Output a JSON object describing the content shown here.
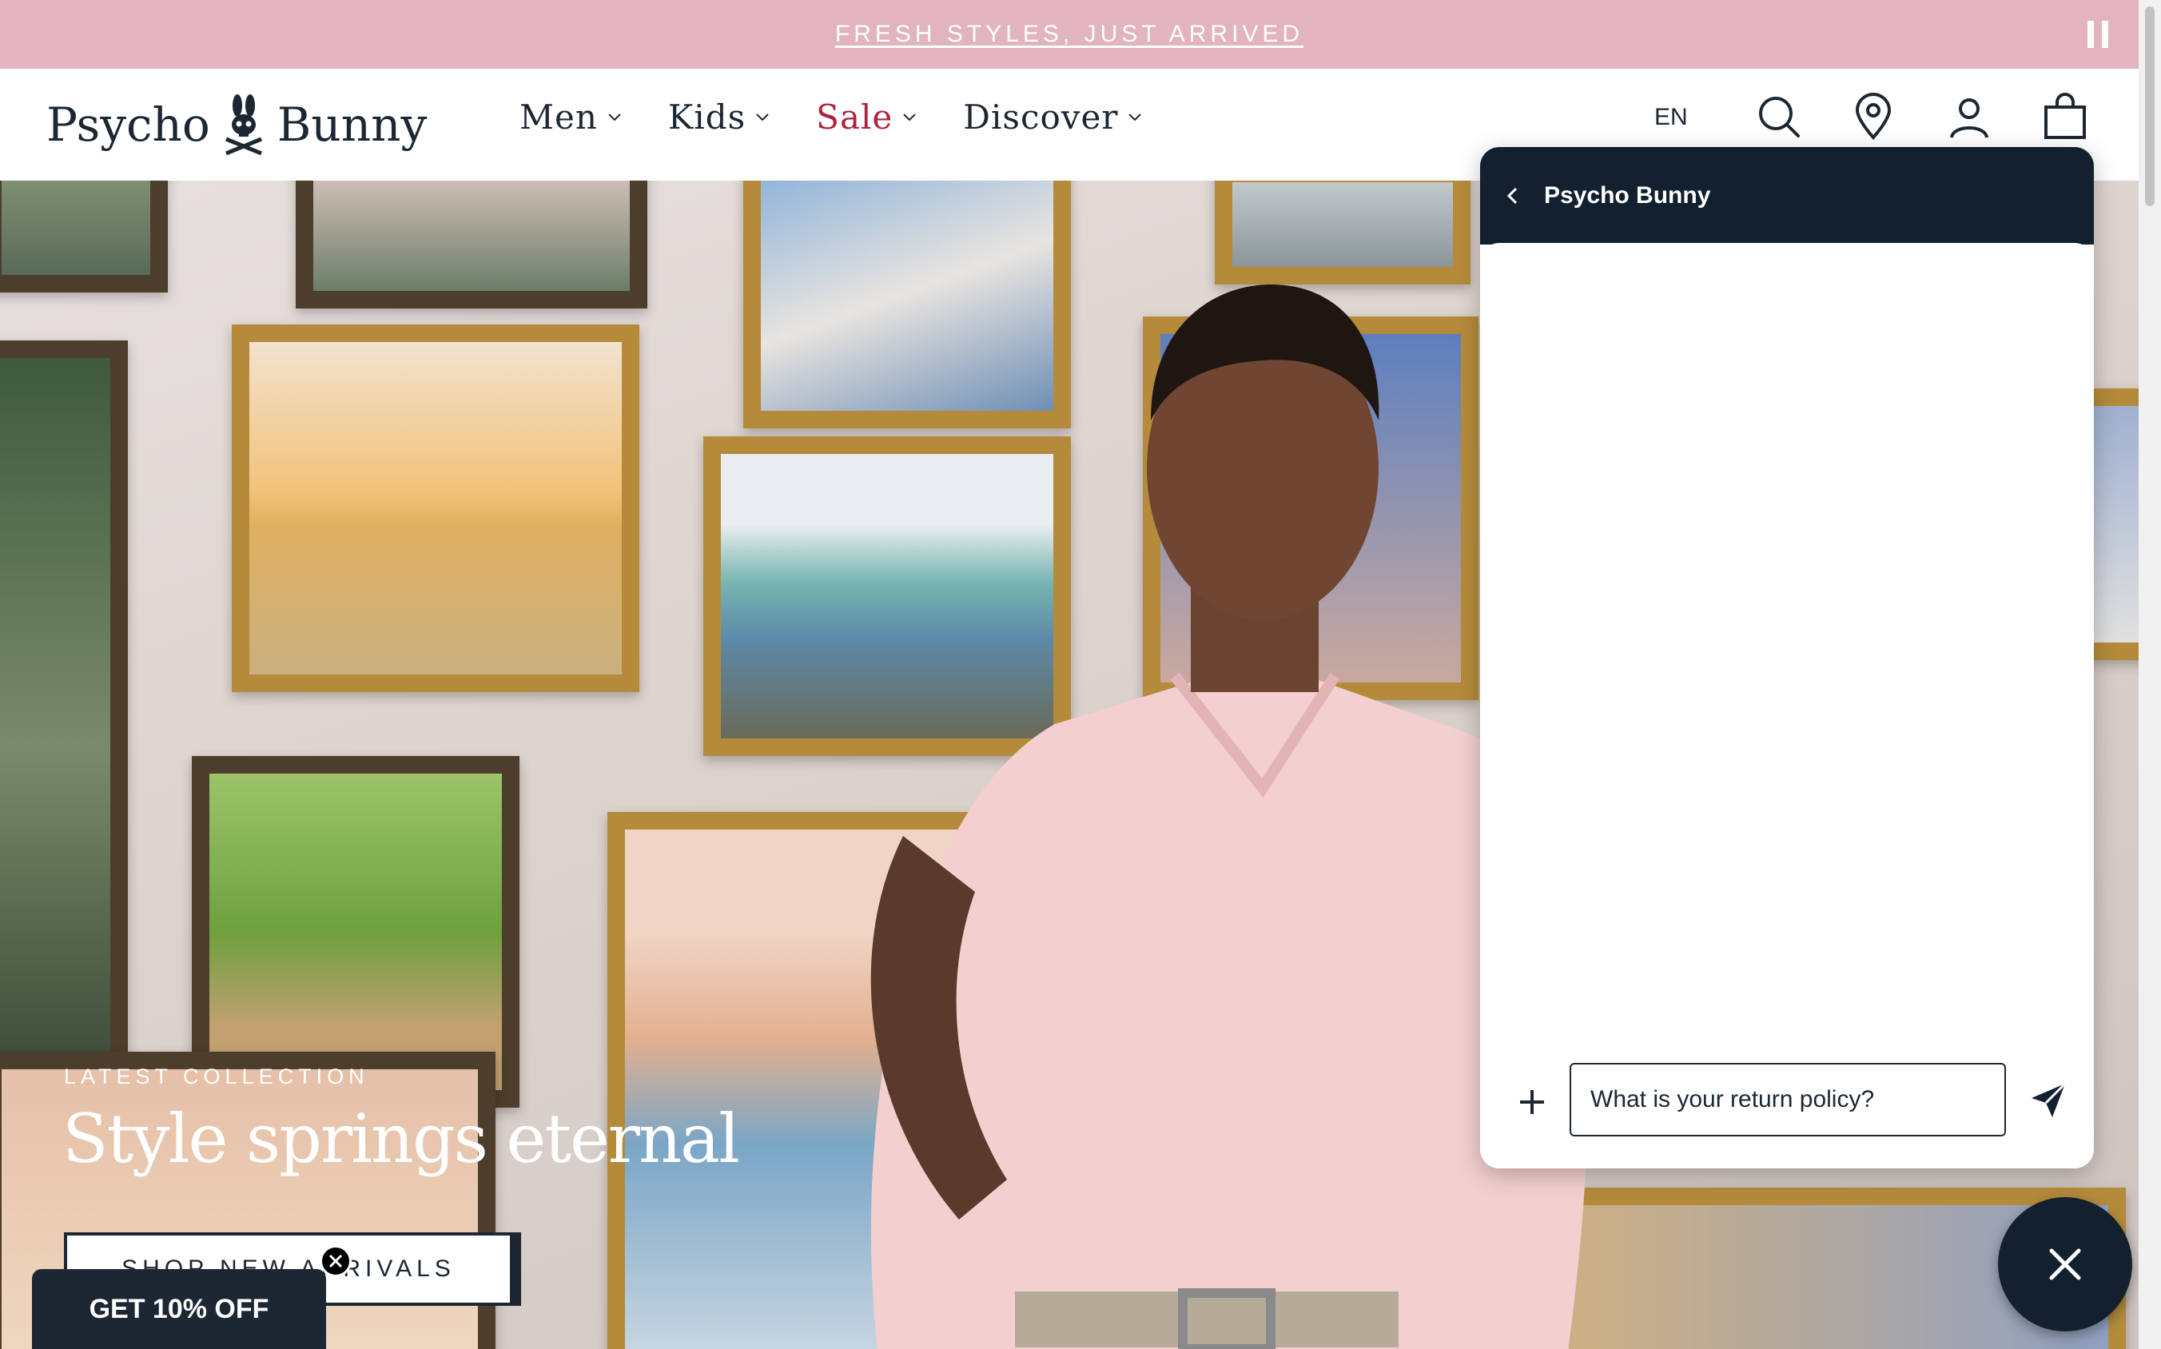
{
  "announcement": {
    "text": "FRESH STYLES, JUST ARRIVED"
  },
  "brand": {
    "name_left": "Psycho",
    "name_right": "Bunny"
  },
  "nav": {
    "items": [
      {
        "label": "Men"
      },
      {
        "label": "Kids"
      },
      {
        "label": "Sale"
      },
      {
        "label": "Discover"
      }
    ]
  },
  "header": {
    "language": "EN"
  },
  "hero": {
    "eyebrow": "LATEST COLLECTION",
    "title": "Style springs eternal",
    "cta": "SHOP NEW ARRIVALS"
  },
  "promo": {
    "label": "GET 10% OFF"
  },
  "chat": {
    "title": "Psycho Bunny",
    "input_value": "What is your return policy?"
  },
  "colors": {
    "announcement_bg": "#e2b4bd",
    "navy": "#12202f",
    "sale_red": "#b0233c"
  }
}
